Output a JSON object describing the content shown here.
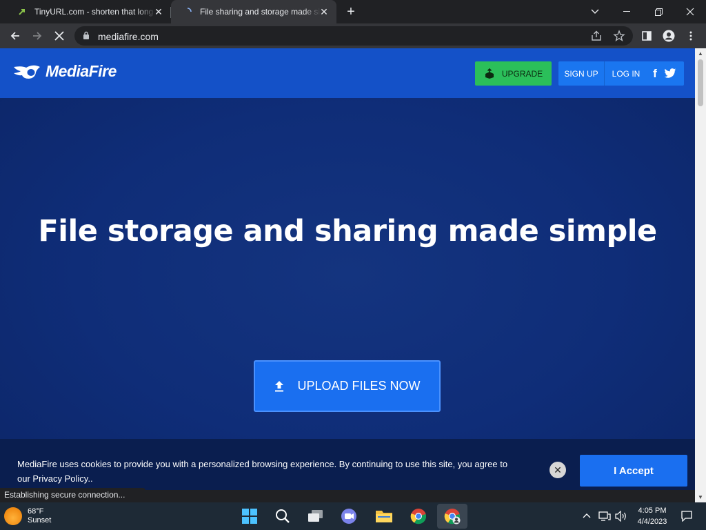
{
  "browser": {
    "tabs": [
      {
        "title": "TinyURL.com - shorten that long",
        "active": false
      },
      {
        "title": "File sharing and storage made simple",
        "active": true
      }
    ],
    "url": "mediafire.com",
    "status_text": "Establishing secure connection..."
  },
  "site": {
    "logo_text": "MediaFire",
    "upgrade_label": "UPGRADE",
    "signup_label": "SIGN UP",
    "login_label": "LOG IN",
    "facebook_glyph": "f",
    "hero_title": "File storage and sharing made simple",
    "upload_label": "UPLOAD FILES NOW",
    "cookie_message": "MediaFire uses cookies to provide you with a personalized browsing experience. By continuing to use this site, you agree to our Privacy Policy..",
    "accept_label": "I Accept",
    "close_glyph": "✕"
  },
  "taskbar": {
    "weather_temp": "68°F",
    "weather_desc": "Sunset",
    "time": "4:05 PM",
    "date": "4/4/2023"
  },
  "colors": {
    "brand_blue": "#1451c8",
    "hero_blue": "#0f2d78",
    "button_blue": "#1a6ff0",
    "upgrade_green": "#2bbf5a"
  }
}
